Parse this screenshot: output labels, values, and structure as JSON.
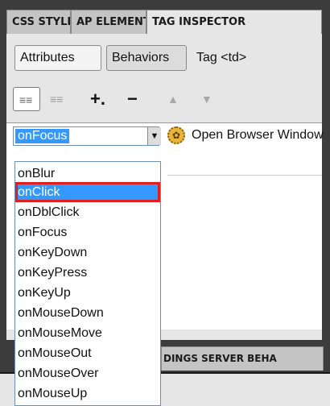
{
  "top_tabs": [
    "CSS STYLES",
    "AP ELEMENTS",
    "TAG INSPECTOR"
  ],
  "sub_tabs": [
    "Attributes",
    "Behaviors"
  ],
  "tag_label": "Tag <td>",
  "toolbar": {
    "show_set_events": "≡≡",
    "show_all_events": "≡≡",
    "add": "+.",
    "remove": "−",
    "up": "▲",
    "down": "▼"
  },
  "behavior": {
    "event_value": "onFocus",
    "action": "Open Browser Window"
  },
  "event_options": [
    "onBlur",
    "onClick",
    "onDblClick",
    "onFocus",
    "onKeyDown",
    "onKeyPress",
    "onKeyUp",
    "onMouseDown",
    "onMouseMove",
    "onMouseOut",
    "onMouseOver",
    "onMouseUp"
  ],
  "highlighted_option": "onClick",
  "lower_tabs_text": "DINGS  SERVER BEHA",
  "colors": {
    "selection": "#3399ff",
    "highlight_border": "#e02020"
  }
}
